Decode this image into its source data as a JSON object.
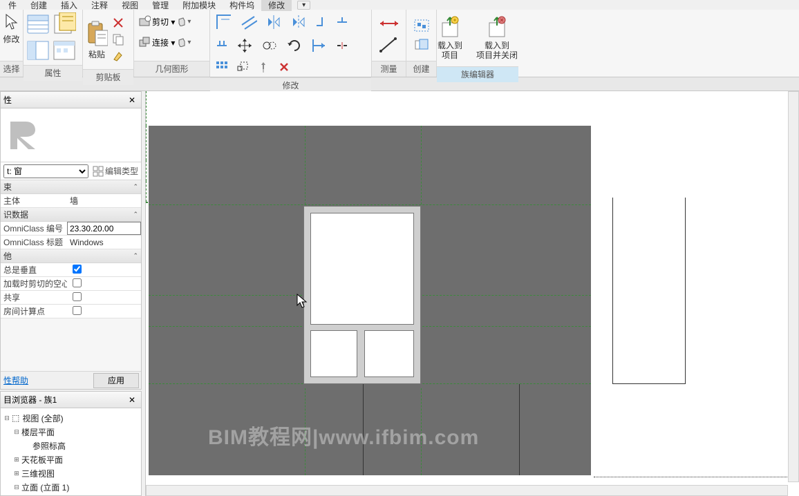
{
  "menu": {
    "items": [
      "件",
      "创建",
      "插入",
      "注释",
      "视图",
      "管理",
      "附加模块",
      "构件坞",
      "修改"
    ],
    "active": 8,
    "dropdown_icon": "▾"
  },
  "ribbon": {
    "select_group": "选择",
    "select_sub": "修改",
    "props_group": "属性",
    "clip_group": "剪贴板",
    "paste": "粘贴",
    "cut": "剪切 ▾",
    "connect": "连接 ▾",
    "geom_group": "几何图形",
    "modify_group": "修改",
    "measure_group": "测量",
    "create_group": "创建",
    "family_group": "族编辑器",
    "load_proj": "载入到\n项目",
    "load_close": "载入到\n项目并关闭"
  },
  "properties": {
    "title": "性",
    "type_selector": "t: 窗",
    "edit_type": "编辑类型",
    "sections": {
      "constraint": "束",
      "identity": "识数据",
      "other": "他"
    },
    "rows": {
      "host_k": "主体",
      "host_v": "墙",
      "omni_num_k": "OmniClass 编号",
      "omni_num_v": "23.30.20.00",
      "omni_title_k": "OmniClass 标题",
      "omni_title_v": "Windows",
      "always_vert_k": "总是垂直",
      "always_vert_v": true,
      "cut_void_k": "加载时剪切的空心",
      "cut_void_v": false,
      "shared_k": "共享",
      "shared_v": false,
      "room_point_k": "房间计算点",
      "room_point_v": false
    },
    "help": "性帮助",
    "apply": "应用"
  },
  "browser": {
    "title": "目浏览器 - 族1",
    "nodes": {
      "views": "视图 (全部)",
      "floor": "楼层平面",
      "ref_level": "参照标高",
      "ceiling": "天花板平面",
      "threeD": "三维视图",
      "elev": "立面 (立面 1)"
    }
  },
  "canvas": {
    "watermark": "BIM教程网|www.ifbim.com"
  }
}
